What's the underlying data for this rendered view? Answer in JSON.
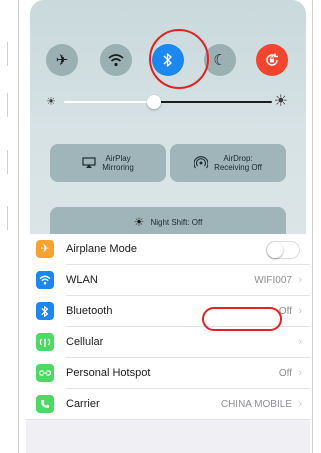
{
  "control_center": {
    "toggles": [
      {
        "name": "airplane",
        "icon": "airplane-icon",
        "active": false
      },
      {
        "name": "wifi",
        "icon": "wifi-icon",
        "active": false
      },
      {
        "name": "bluetooth",
        "icon": "bluetooth-icon",
        "active": true,
        "color": "#1c87f0"
      },
      {
        "name": "do-not-disturb",
        "icon": "moon-icon",
        "active": false
      },
      {
        "name": "rotation-lock",
        "icon": "rotation-lock-icon",
        "active": true,
        "color": "#f2452f"
      }
    ],
    "brightness_level": 0.45,
    "airplay": {
      "line1": "AirPlay",
      "line2": "Mirroring"
    },
    "airdrop": {
      "line1": "AirDrop:",
      "line2": "Receiving Off"
    },
    "night_shift": "Night Shift: Off"
  },
  "settings": {
    "rows": [
      {
        "label": "Airplane Mode",
        "value": "",
        "icon": "airplane-icon",
        "color": "#f7a12f",
        "type": "switch",
        "switch_on": false
      },
      {
        "label": "WLAN",
        "value": "WIFI007",
        "icon": "wifi-icon",
        "color": "#1c87f0",
        "type": "link"
      },
      {
        "label": "Bluetooth",
        "value": "Off",
        "icon": "bluetooth-icon",
        "color": "#1c87f0",
        "type": "link"
      },
      {
        "label": "Cellular",
        "value": "",
        "icon": "cellular-icon",
        "color": "#4cd964",
        "type": "link"
      },
      {
        "label": "Personal Hotspot",
        "value": "Off",
        "icon": "hotspot-icon",
        "color": "#4cd964",
        "type": "link"
      },
      {
        "label": "Carrier",
        "value": "CHINA MOBILE",
        "icon": "phone-icon",
        "color": "#4cd964",
        "type": "link"
      }
    ]
  },
  "annotations": {
    "highlight_color": "#e22222"
  }
}
